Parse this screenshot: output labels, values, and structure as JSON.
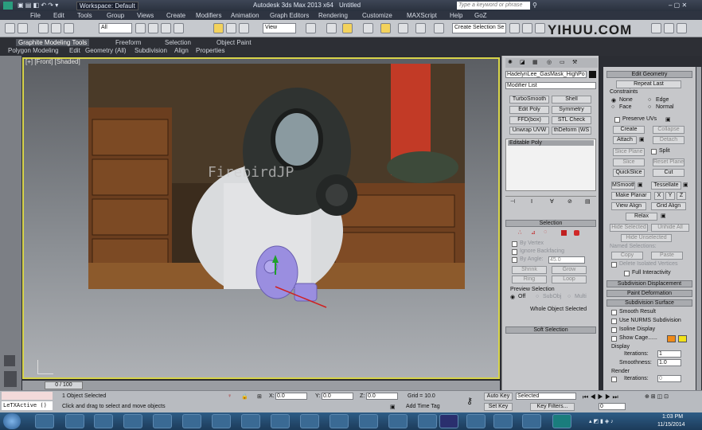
{
  "titlebar": {
    "workspace": "Workspace: Default",
    "app": "Autodesk 3ds Max 2013 x64",
    "doc": "Untitled",
    "search_placeholder": "Type a keyword or phrase"
  },
  "menu": [
    "File",
    "Edit",
    "Tools",
    "Group",
    "Views",
    "Create",
    "Modifiers",
    "Animation",
    "Graph Editors",
    "Rendering",
    "Customize",
    "MAXScript",
    "Help",
    "GoZ"
  ],
  "toolbar": {
    "filter": "All",
    "view": "View",
    "named_selection": "Create Selection Se"
  },
  "watermark": "YIHUU.COM",
  "ribbon": {
    "row1": [
      "Graphite Modeling Tools",
      "Freeform",
      "Selection",
      "Object Paint"
    ],
    "row2": [
      "Polygon Modeling",
      "Edit",
      "Geometry (All)",
      "Subdivision",
      "Align",
      "Properties"
    ]
  },
  "viewport": {
    "label": "[+] [Front] [Shaded]",
    "photo_watermark": "FirebirdJP"
  },
  "cmd": {
    "object_name": "HadelynLee_GasMask_HighPo",
    "modifier_list": "Modifier List",
    "buttons": [
      "TurboSmooth",
      "Shell",
      "Edit Poly",
      "Symmetry",
      "FFD(box)",
      "STL Check",
      "Unwrap UVW",
      "thDeform (WS"
    ],
    "stack_item": "Editable Poly",
    "selection_header": "Selection",
    "by_vertex": "By Vertex",
    "ignore_backfacing": "Ignore Backfacing",
    "by_angle": "By Angle:",
    "angle": "45.0",
    "shrink": "Shrink",
    "grow": "Grow",
    "ring": "Ring",
    "loop": "Loop",
    "preview_header": "Preview Selection",
    "off": "Off",
    "subobj": "SubObj",
    "multi": "Multi",
    "whole_object": "Whole Object Selected",
    "soft_selection": "Soft Selection"
  },
  "edit": {
    "header": "Edit Geometry",
    "repeat_last": "Repeat Last",
    "constraints": "Constraints",
    "none": "None",
    "edge": "Edge",
    "face": "Face",
    "normal": "Normal",
    "preserve_uvs": "Preserve UVs",
    "create": "Create",
    "collapse": "Collapse",
    "attach": "Attach",
    "detach": "Detach",
    "slice_plane": "Slice Plane",
    "split": "Split",
    "slice": "Slice",
    "reset_plane": "Reset Plane",
    "quickslice": "QuickSlice",
    "cut": "Cut",
    "msmooth": "MSmooth",
    "tessellate": "Tessellate",
    "make_planar": "Make Planar",
    "xyz": [
      "X",
      "Y",
      "Z"
    ],
    "view_align": "View Align",
    "grid_align": "Grid Align",
    "relax": "Relax",
    "hide_selected": "Hide Selected",
    "unhide_all": "Unhide All",
    "hide_unselected": "Hide Unselected",
    "named_sel": "Named Selections:",
    "copy": "Copy",
    "paste": "Paste",
    "delete_iso": "Delete Isolated Vertices",
    "full_interactivity": "Full Interactivity",
    "subdiv_disp": "Subdivision Displacement",
    "paint_def": "Paint Deformation",
    "subdiv_surface": "Subdivision Surface",
    "smooth_result": "Smooth Result",
    "use_nurms": "Use NURMS Subdivision",
    "isoline": "Isoline Display",
    "show_cage": "Show Cage......",
    "display": "Display",
    "iterations_label": "Iterations:",
    "iterations": "1",
    "smoothness_label": "Smoothness:",
    "smoothness": "1.0",
    "render": "Render",
    "iterations_r": "0",
    "cage_colors": [
      "#f08a18",
      "#f2e21a"
    ]
  },
  "timeline": {
    "frame": "0 / 100"
  },
  "status": {
    "script": "LeTXActive ()",
    "selected": "1 Object Selected",
    "hint": "Click and drag to select and move objects",
    "x": "0.0",
    "y": "0.0",
    "z": "0.0",
    "grid": "Grid = 10.0",
    "add_time_tag": "Add Time Tag",
    "auto_key": "Auto Key",
    "set_key": "Set Key",
    "selected_dd": "Selected",
    "key_filters": "Key Filters...",
    "frame_field": "0"
  },
  "taskbar": {
    "time": "1:03 PM",
    "date": "11/15/2014"
  },
  "colors": {
    "viewport_border": "#d7d449",
    "title": "#2a313e"
  }
}
